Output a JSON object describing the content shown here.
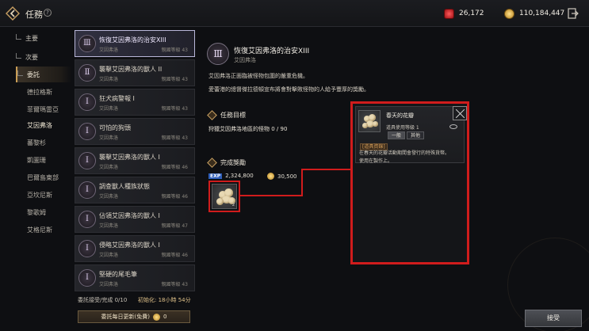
{
  "header": {
    "title": "任務",
    "help": "?",
    "ruby_amount": "26,172",
    "gold_amount": "110,184,447"
  },
  "sidebar": {
    "items": [
      {
        "label": "主要"
      },
      {
        "label": "次要"
      },
      {
        "label": "委託"
      }
    ],
    "subitems": [
      {
        "label": "德拉格斯"
      },
      {
        "label": "菲爾瑪雷亞"
      },
      {
        "label": "艾因弗洛"
      },
      {
        "label": "蕃黎杉"
      },
      {
        "label": "凱圖珊"
      },
      {
        "label": "巴爾島東部"
      },
      {
        "label": "亞坎尼斯"
      },
      {
        "label": "黎歌姆"
      },
      {
        "label": "艾格尼斯"
      }
    ]
  },
  "quests": [
    {
      "badge": "Ⅲ",
      "name": "恢復艾因弗洛的治安XIII",
      "region": "艾因弗洛",
      "level": "親國等級 43"
    },
    {
      "badge": "Ⅱ",
      "name": "襲擊艾因弗洛的獸人 II",
      "region": "艾因弗洛",
      "level": "親國等級 43"
    },
    {
      "badge": "Ⅰ",
      "name": "狂犬病警報 I",
      "region": "艾因弗洛",
      "level": "親國等級 43"
    },
    {
      "badge": "Ⅰ",
      "name": "可怕的狗頭",
      "region": "艾因弗洛",
      "level": "親國等級 43"
    },
    {
      "badge": "Ⅰ",
      "name": "襲擊艾因弗洛的獸人 I",
      "region": "艾因弗洛",
      "level": "親國等級 46"
    },
    {
      "badge": "Ⅰ",
      "name": "調查獸人種族狀態",
      "region": "艾因弗洛",
      "level": "親國等級 46"
    },
    {
      "badge": "Ⅰ",
      "name": "佔領艾因弗洛的獸人 I",
      "region": "艾因弗洛",
      "level": "親國等級 47"
    },
    {
      "badge": "Ⅰ",
      "name": "侵略艾因弗洛的獸人 I",
      "region": "艾因弗洛",
      "level": "親國等級 46"
    },
    {
      "badge": "Ⅰ",
      "name": "堅硬的尾毛筆",
      "region": "艾因弗洛",
      "level": "親國等級 43"
    }
  ],
  "footer": {
    "accepted": "委託接受/完成 0/10",
    "reset": "初始化: 18小時 54分",
    "refresh_label": "委託每日更新(免費)",
    "refresh_cost": "0"
  },
  "detail": {
    "badge": "Ⅲ",
    "title": "恢復艾因弗洛的治安XIII",
    "region": "艾因弗洛",
    "description": "艾因弗洛正面臨被怪物包圍的嚴重危機。\n愛蕾港的總督傑拉德頓宣布將會對擊敗怪物的人給予豐厚的獎勵。",
    "objective_head": "任務目標",
    "objective": "狩獵艾因弗洛地區的怪物 0 / 90",
    "reward_head": "完成獎勵",
    "exp_tag": "EXP",
    "exp_value": "2,324,800",
    "gold_value": "30,500",
    "item_count": "2"
  },
  "tooltip": {
    "name": "春天的花瓣",
    "class_line": "道具使用等級 1",
    "chip1": "一般",
    "chip2": "其他",
    "category": "[道具資錄]",
    "description": "在春天的花瓣活動期間會發行的特殊貨幣。\n使用在製作上。"
  },
  "actions": {
    "accept_label": "接受"
  }
}
